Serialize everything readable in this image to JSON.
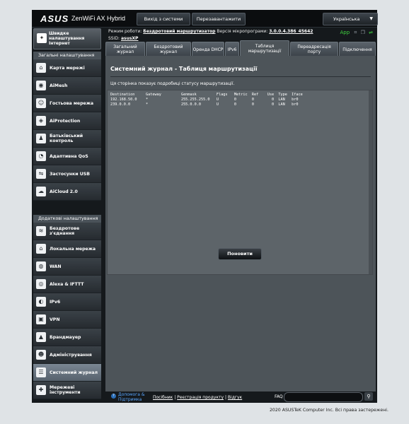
{
  "header": {
    "logo": "ASUS",
    "product": "ZenWiFi AX Hybrid",
    "logout": "Вихід з системи",
    "reboot": "Перезавантажити",
    "language": "Українська"
  },
  "info": {
    "mode_label": "Режим роботи:",
    "mode_value": "Бездротовий маршрутизатор",
    "fw_label": "Версія мікропрограми:",
    "fw_value": "3.0.0.4.386_45642",
    "ssid_label": "SSID:",
    "ssid_value": "asusXP",
    "app": "App"
  },
  "sidebar": {
    "quick": "Швидке налаштування Інтернет",
    "general_header": "Загальні налаштування",
    "general": [
      {
        "label": "Карта мережі",
        "icon": "map-icon"
      },
      {
        "label": "AiMesh",
        "icon": "aimesh-icon"
      },
      {
        "label": "Гостьова мережа",
        "icon": "guest-icon"
      },
      {
        "label": "AiProtection",
        "icon": "protection-icon"
      },
      {
        "label": "Батьківський контроль",
        "icon": "parental-icon"
      },
      {
        "label": "Адаптивна QoS",
        "icon": "qos-icon"
      },
      {
        "label": "Застосунки USB",
        "icon": "usb-icon"
      },
      {
        "label": "AiCloud 2.0",
        "icon": "cloud-icon"
      }
    ],
    "advanced_header": "Додаткові налаштування",
    "advanced": [
      {
        "label": "Бездротове з'єднання",
        "icon": "wifi-icon"
      },
      {
        "label": "Локальна мережа",
        "icon": "lan-icon"
      },
      {
        "label": "WAN",
        "icon": "wan-icon"
      },
      {
        "label": "Alexa & IFTTT",
        "icon": "alexa-icon"
      },
      {
        "label": "IPv6",
        "icon": "ipv6-icon"
      },
      {
        "label": "VPN",
        "icon": "vpn-icon"
      },
      {
        "label": "Брандмауер",
        "icon": "firewall-icon"
      },
      {
        "label": "Адміністрування",
        "icon": "admin-icon"
      },
      {
        "label": "Системний журнал",
        "icon": "log-icon"
      },
      {
        "label": "Мережеві інструменти",
        "icon": "tools-icon"
      }
    ]
  },
  "tabs": [
    "Загальний журнал",
    "Бездротовий журнал",
    "Оренда DHCP",
    "IPv6",
    "Таблиця маршрутизації",
    "Переадресація порту",
    "Підключення"
  ],
  "content": {
    "title": "Системний журнал - Таблиця маршрутизації",
    "description": "Ця сторінка показує подробиці статусу маршрутизації.",
    "log": "Destination     Gateway         Genmask         Flags   Metric  Ref    Use  Type  Iface\n192.168.50.0    *               255.255.255.0   U       0       0        0  LAN   br0\n239.0.0.0       *               255.0.0.0       U       0       0        0  LAN   br0",
    "refresh": "Поновити"
  },
  "footer": {
    "help": "Допомога & Підтримка",
    "manual": "Посібник",
    "registration": "Реєстрація продукту",
    "feedback": "Відгук",
    "faq": "FAQ",
    "copyright": "2020 ASUSTeK Computer Inc. Всі права застережені."
  },
  "colors": {
    "accent": "#5aa7ff",
    "app": "#3fd13f",
    "background": "#15191c"
  }
}
